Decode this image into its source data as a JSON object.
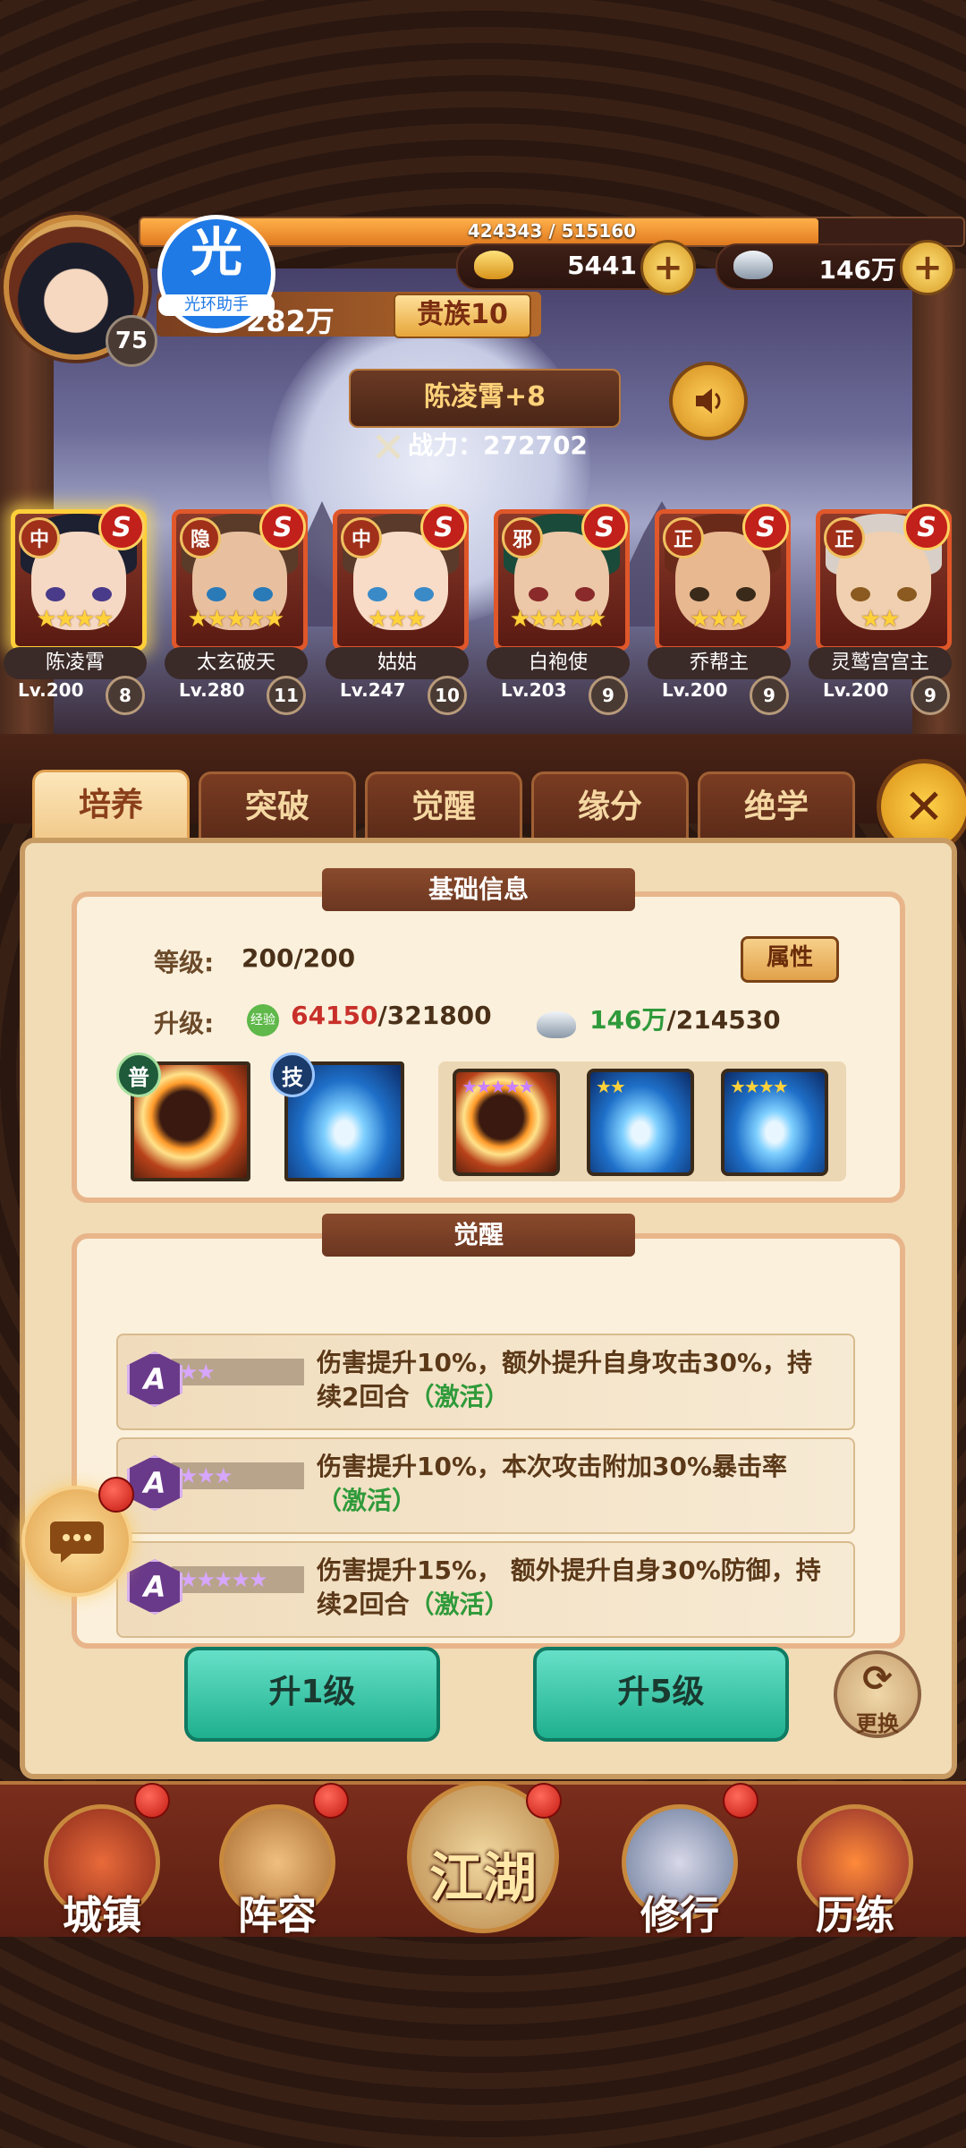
{
  "player": {
    "level": "75",
    "exp_text": "424343 / 515160",
    "exp_fraction": 0.8237,
    "gold": "5441",
    "silver": "146万",
    "power": "282万",
    "vip": "贵族10",
    "halo_icon": "光",
    "halo_label": "光环助手"
  },
  "hero_detail": {
    "name": "陈凌霄+8",
    "battle_label": "战力：",
    "battle_value": "272702"
  },
  "roster": [
    {
      "name": "陈凌霄",
      "level": "Lv.200",
      "count": "8",
      "faction": "中",
      "grade": "S",
      "stars": "★★★★",
      "selected": true,
      "hair": "#1c2030",
      "skin": "#f6d9c4",
      "eye": "#4a3a8a"
    },
    {
      "name": "太玄破天",
      "level": "Lv.280",
      "count": "11",
      "faction": "隐",
      "grade": "S",
      "stars": "★★★★★",
      "selected": false,
      "hair": "#5a3a28",
      "skin": "#e8c0a0",
      "eye": "#2a7ab8"
    },
    {
      "name": "姑姑",
      "level": "Lv.247",
      "count": "10",
      "faction": "中",
      "grade": "S",
      "stars": "★★★",
      "selected": false,
      "hair": "#5a3a2a",
      "skin": "#f8dcc8",
      "eye": "#3a8ac8"
    },
    {
      "name": "白袍使",
      "level": "Lv.203",
      "count": "9",
      "faction": "邪",
      "grade": "S",
      "stars": "★★★★★",
      "selected": false,
      "hair": "#1a4a3a",
      "skin": "#ecc8a8",
      "eye": "#8a2a2a"
    },
    {
      "name": "乔帮主",
      "level": "Lv.200",
      "count": "9",
      "faction": "正",
      "grade": "S",
      "stars": "★★★",
      "selected": false,
      "hair": "#6a2a1a",
      "skin": "#e8b890",
      "eye": "#3a2a1a"
    },
    {
      "name": "灵鹫宫宫主",
      "level": "Lv.200",
      "count": "9",
      "faction": "正",
      "grade": "S",
      "stars": "★★",
      "selected": false,
      "hair": "#d8d0c8",
      "skin": "#f0d0b0",
      "eye": "#8a5a20"
    }
  ],
  "tabs": [
    "培养",
    "突破",
    "觉醒",
    "缘分",
    "绝学"
  ],
  "active_tab": 0,
  "basic_info": {
    "title": "基础信息",
    "level_label": "等级:",
    "level_value": "200/200",
    "attr_button": "属性",
    "upgrade_label": "升级:",
    "exp_icon": "经验",
    "exp_current": "64150",
    "exp_total": "/321800",
    "silver_current": "146万",
    "silver_total": "/214530",
    "skill_tags": [
      "普",
      "技"
    ],
    "skill_stars": [
      "★★★★★",
      "★★",
      "★★★★"
    ]
  },
  "awakening": {
    "title": "觉醒",
    "items": [
      {
        "badge": "A",
        "stars": "★★",
        "text": "伤害提升10%，额外提升自身攻击30%，持续2回合",
        "status": "（激活）"
      },
      {
        "badge": "A",
        "stars": "★★★",
        "text": "伤害提升10%，本次攻击附加30%暴击率",
        "status": "（激活）"
      },
      {
        "badge": "A",
        "stars": "★★★★★",
        "text": "伤害提升15%， 额外提升自身30%防御，持续2回合",
        "status": "（激活）"
      }
    ]
  },
  "actions": {
    "up1": "升1级",
    "up5": "升5级",
    "swap": "更换"
  },
  "nav": [
    {
      "label": "城镇"
    },
    {
      "label": "阵容"
    },
    {
      "label": "江湖"
    },
    {
      "label": "修行"
    },
    {
      "label": "历练"
    }
  ],
  "colors": {
    "accent_gold": "#ffcf3a",
    "exp_red": "#c8302a",
    "silver_green": "#2f9a3a",
    "active_green": "#2f9a3a"
  }
}
